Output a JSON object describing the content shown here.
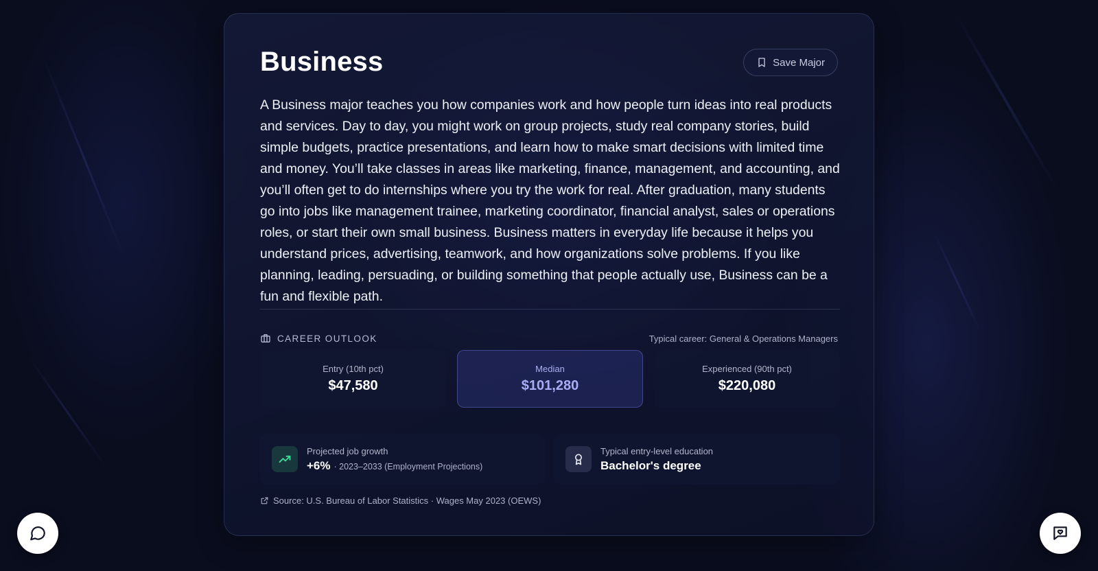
{
  "major": {
    "title": "Business",
    "save_label": "Save Major",
    "description": "A Business major teaches you how companies work and how people turn ideas into real products and services. Day to day, you might work on group projects, study real company stories, build simple budgets, practice presentations, and learn how to make smart decisions with limited time and money. You’ll take classes in areas like marketing, finance, management, and accounting, and you’ll often get to do internships where you try the work for real. After graduation, many students go into jobs like management trainee, marketing coordinator, financial analyst, sales or operations roles, or start their own small business. Business matters in everyday life because it helps you understand prices, advertising, teamwork, and how organizations solve problems. If you like planning, leading, persuading, or building something that people actually use, Business can be a fun and flexible path."
  },
  "career_outlook": {
    "heading": "CAREER OUTLOOK",
    "typical_career": "Typical career: General & Operations Managers",
    "wages": [
      {
        "label": "Entry (10th pct)",
        "value": "$47,580"
      },
      {
        "label": "Median",
        "value": "$101,280"
      },
      {
        "label": "Experienced (90th pct)",
        "value": "$220,080"
      }
    ],
    "growth": {
      "label": "Projected job growth",
      "value": "+6%",
      "detail": "· 2023–2033 (Employment Projections)"
    },
    "education": {
      "label": "Typical entry-level education",
      "value": "Bachelor's degree"
    },
    "source": "Source: U.S. Bureau of Labor Statistics · Wages May 2023 (OEWS)"
  },
  "colors": {
    "background": "#0a0d1e",
    "accent": "#a7aef5",
    "growth_green": "#3ddc97"
  },
  "icons": {
    "save": "bookmark-icon",
    "section": "briefcase-icon",
    "growth": "trending-up-icon",
    "education": "award-icon",
    "source": "external-link-icon",
    "chat": "chat-bubble-icon",
    "feedback": "heart-message-icon"
  }
}
